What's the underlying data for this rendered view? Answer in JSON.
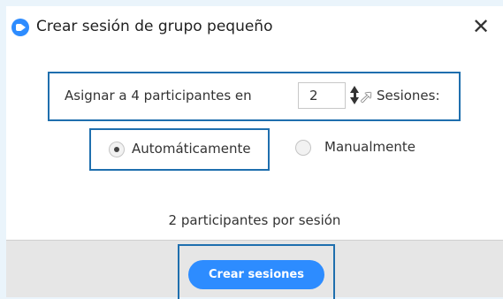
{
  "dialog": {
    "title": "Crear sesión de grupo pequeño",
    "close_glyph": "✕",
    "icon": "zoom-camera-icon"
  },
  "assign": {
    "text": "Asignar a 4 participantes en",
    "sessions_value": "2",
    "sessions_label": "Sesiones:"
  },
  "mode": {
    "options": [
      {
        "label": "Automáticamente",
        "checked": true
      },
      {
        "label": "Manualmente",
        "checked": false
      }
    ]
  },
  "summary": {
    "text": "2 participantes por sesión"
  },
  "footer": {
    "create_label": "Crear sesiones"
  },
  "colors": {
    "accent": "#2d8cff",
    "highlight_border": "#1f6fae",
    "footer_bg": "#e6e6e6",
    "page_bg": "#eaf4fb"
  }
}
